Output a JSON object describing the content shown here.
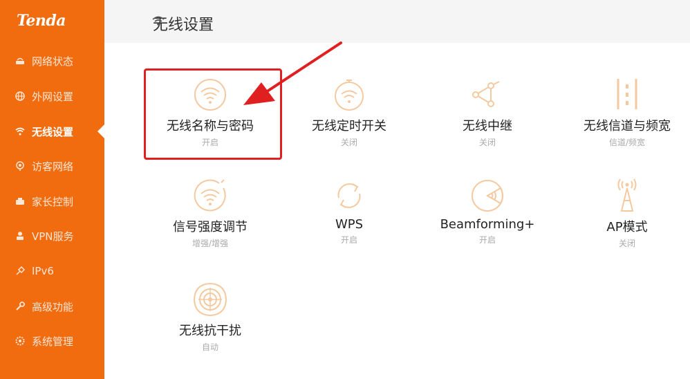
{
  "brand": {
    "logo_text": "Tenda",
    "accent": "#f06c0f",
    "icon_color": "#f5c9a0"
  },
  "sidebar": {
    "items": [
      {
        "label": "网络状态",
        "icon": "router-icon",
        "active": false
      },
      {
        "label": "外网设置",
        "icon": "globe-icon",
        "active": false
      },
      {
        "label": "无线设置",
        "icon": "wifi-icon",
        "active": true
      },
      {
        "label": "访客网络",
        "icon": "guest-icon",
        "active": false
      },
      {
        "label": "家长控制",
        "icon": "parental-icon",
        "active": false
      },
      {
        "label": "VPN服务",
        "icon": "vpn-icon",
        "active": false
      },
      {
        "label": "IPv6",
        "icon": "ipv6-icon",
        "active": false
      },
      {
        "label": "高级功能",
        "icon": "wrench-icon",
        "active": false
      },
      {
        "label": "系统管理",
        "icon": "gear-icon",
        "active": false
      }
    ]
  },
  "header": {
    "title": "无线设置",
    "icon": "wifi-icon"
  },
  "tiles": [
    {
      "name": "无线名称与密码",
      "status": "开启",
      "icon": "wifi-icon"
    },
    {
      "name": "无线定时开关",
      "status": "关闭",
      "icon": "wifi-timer-icon"
    },
    {
      "name": "无线中继",
      "status": "关闭",
      "icon": "relay-icon"
    },
    {
      "name": "无线信道与频宽",
      "status": "信道/频宽",
      "icon": "channel-icon"
    },
    {
      "name": "信号强度调节",
      "status": "增强/增强",
      "icon": "signal-strength-icon"
    },
    {
      "name": "WPS",
      "status": "开启",
      "icon": "wps-icon"
    },
    {
      "name": "Beamforming+",
      "status": "开启",
      "icon": "beamforming-icon"
    },
    {
      "name": "AP模式",
      "status": "关闭",
      "icon": "antenna-icon"
    },
    {
      "name": "无线抗干扰",
      "status": "自动",
      "icon": "anti-interference-icon"
    }
  ],
  "annotation": {
    "highlight_color": "#e02020"
  }
}
